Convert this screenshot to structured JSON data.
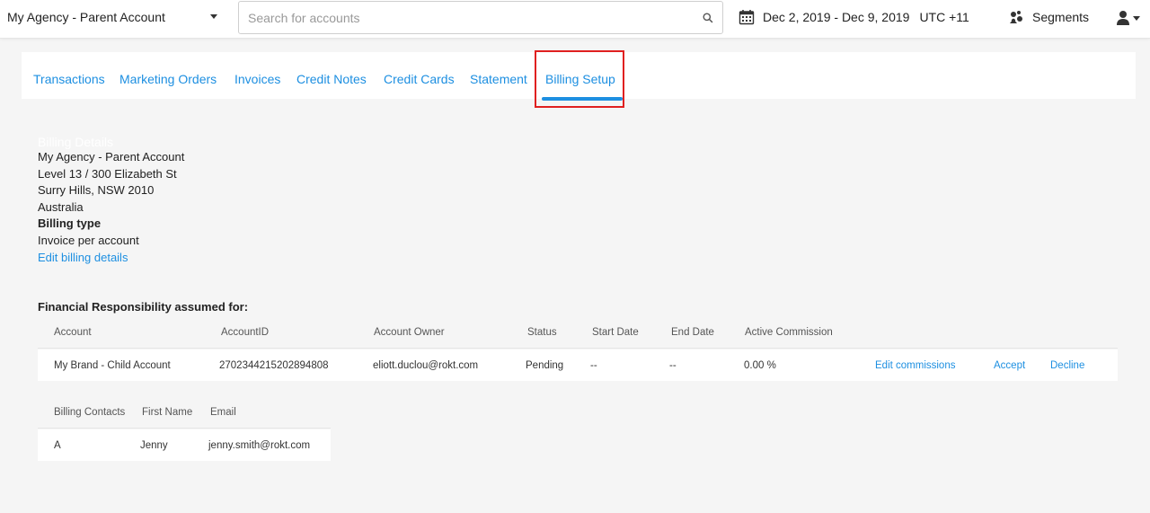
{
  "header": {
    "account_name": "My Agency - Parent Account",
    "search": {
      "placeholder": "Search for accounts",
      "value": ""
    },
    "date_range": "Dec 2, 2019 - Dec 9, 2019",
    "timezone": "UTC +11",
    "segments_label": "Segments"
  },
  "tabs": [
    {
      "label": "Transactions"
    },
    {
      "label": "Marketing Orders"
    },
    {
      "label": "Invoices"
    },
    {
      "label": "Credit Notes"
    },
    {
      "label": "Credit Cards"
    },
    {
      "label": "Statement"
    },
    {
      "label": "Billing Setup",
      "active": true
    }
  ],
  "billing": {
    "heading": "Billing Details",
    "name": "My Agency - Parent Account",
    "address1": "Level 13 / 300 Elizabeth St",
    "address2": "Surry Hills, NSW 2010",
    "country": "Australia",
    "type_label": "Billing type",
    "type_value": "Invoice per account",
    "edit_link": "Edit billing details"
  },
  "financial": {
    "heading": "Financial Responsibility assumed for:",
    "columns": [
      "Account",
      "AccountID",
      "Account Owner",
      "Status",
      "Start Date",
      "End Date",
      "Active Commission"
    ],
    "rows": [
      {
        "account": "My Brand - Child Account",
        "account_id": "2702344215202894808",
        "owner": "eliott.duclou@rokt.com",
        "status": "Pending",
        "start_date": "--",
        "end_date": "--",
        "commission": "0.00 %",
        "edit_commissions": "Edit commissions",
        "accept": "Accept",
        "decline": "Decline"
      }
    ]
  },
  "contacts": {
    "columns": [
      "Billing Contacts",
      "First Name",
      "Email"
    ],
    "rows": [
      {
        "contact": "A",
        "first_name": "Jenny",
        "email": "jenny.smith@rokt.com"
      }
    ]
  },
  "colors": {
    "accent": "#1d8fe1",
    "highlight": "#e02020",
    "background": "#f5f5f5"
  }
}
